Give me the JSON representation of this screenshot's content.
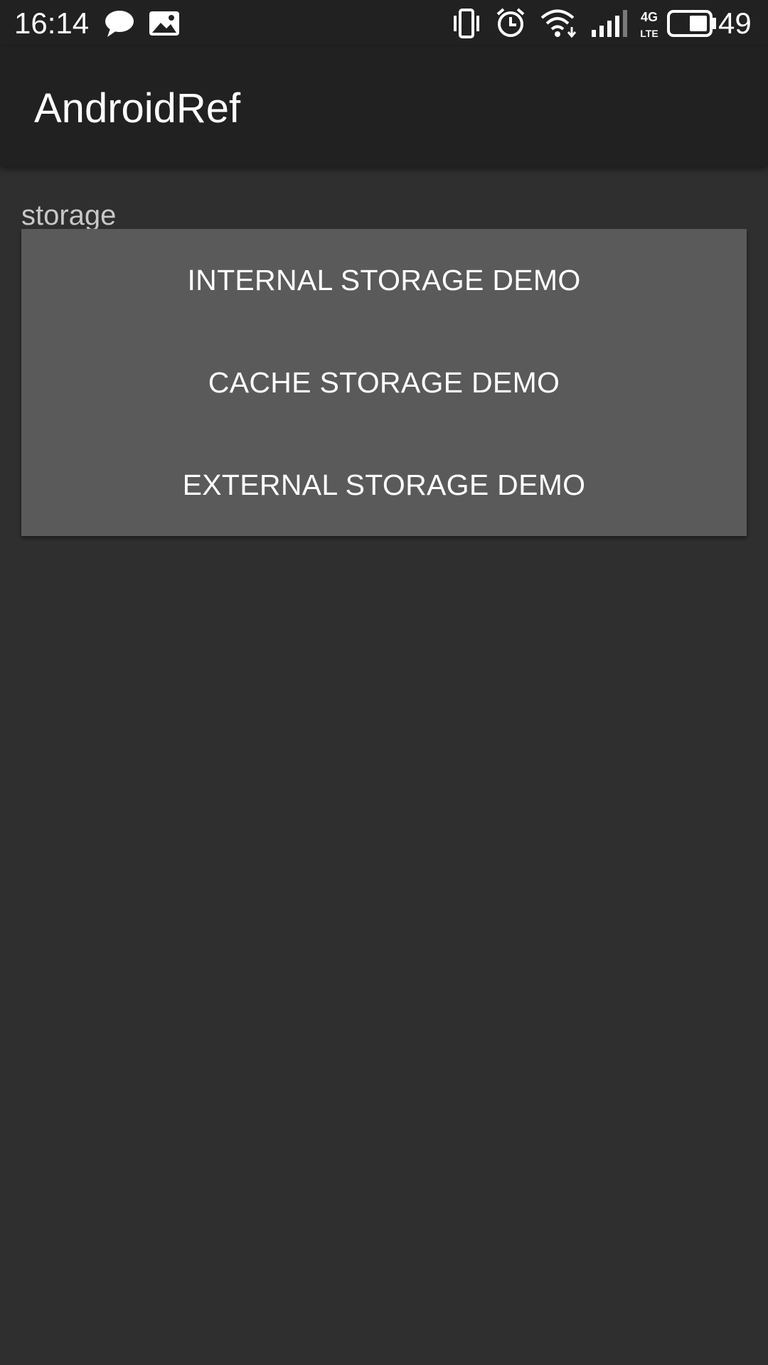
{
  "status_bar": {
    "time": "16:14",
    "battery_percent": "49",
    "network_label_top": "4G",
    "network_label_bottom": "LTE",
    "icons": [
      "chat-bubble-icon",
      "image-notification-icon",
      "vibrate-icon",
      "alarm-icon",
      "wifi-icon",
      "cell-signal-icon",
      "network-4g-lte-icon",
      "battery-icon"
    ]
  },
  "app_bar": {
    "title": "AndroidRef"
  },
  "storage": {
    "section_label": "storage",
    "buttons": [
      {
        "label": "INTERNAL STORAGE DEMO"
      },
      {
        "label": "CACHE STORAGE DEMO"
      },
      {
        "label": "EXTERNAL STORAGE DEMO"
      }
    ]
  },
  "colors": {
    "status_bar_bg": "#212121",
    "app_bar_bg": "#212121",
    "content_bg": "#2f2f2f",
    "card_bg": "#5a5a5a",
    "label_text": "#c8c8c8",
    "button_text": "#ffffff"
  }
}
